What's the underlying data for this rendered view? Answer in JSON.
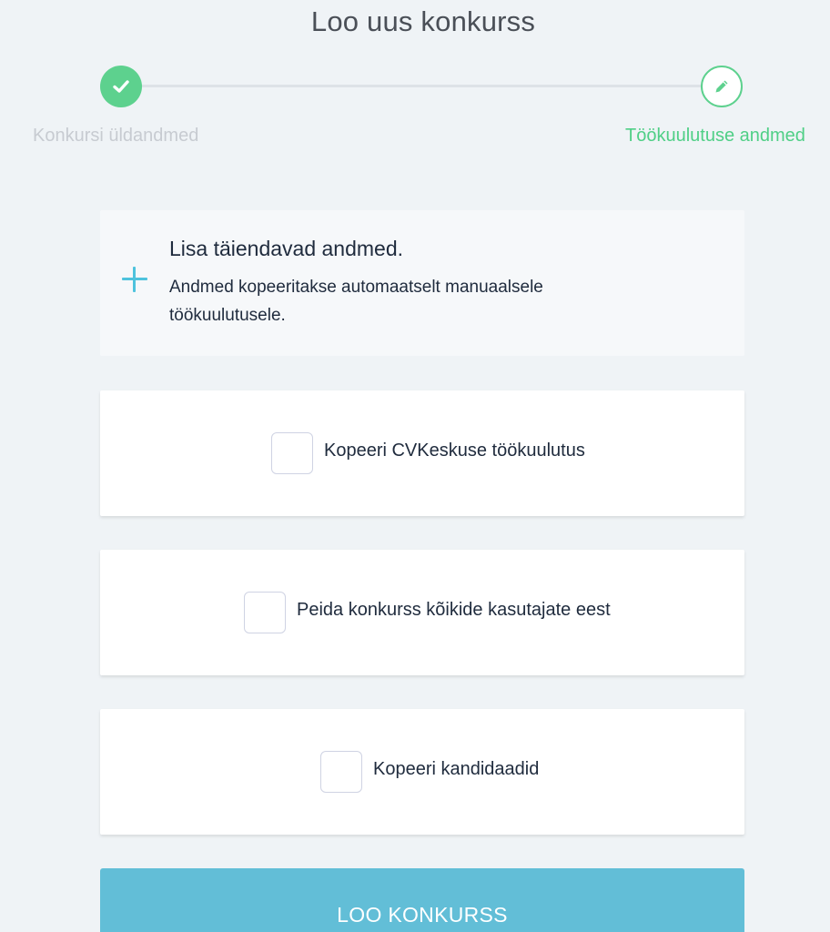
{
  "page": {
    "title": "Loo uus konkurss"
  },
  "stepper": {
    "steps": [
      {
        "label": "Konkursi üldandmed",
        "status": "completed",
        "icon": "check-icon"
      },
      {
        "label": "Töökuulutuse andmed",
        "status": "active",
        "icon": "pencil-icon"
      }
    ]
  },
  "info": {
    "icon": "plus-icon",
    "heading": "Lisa täiendavad andmed.",
    "text": "Andmed kopeeritakse automaatselt manuaalsele töökuulutusele."
  },
  "options": [
    {
      "label": "Kopeeri CVKeskuse töökuulutus",
      "checked": false
    },
    {
      "label": "Peida konkurss kõikide kasutajate eest",
      "checked": false
    },
    {
      "label": "Kopeeri kandidaadid",
      "checked": false
    }
  ],
  "submit": {
    "label": "LOO KONKURSS"
  },
  "colors": {
    "background": "#eff3f6",
    "success_green": "#5dd18e",
    "accent_blue": "#62bed7",
    "plus_blue": "#4ec3dd",
    "text_dark": "#1f2b3d",
    "text_muted": "#c7cbd1"
  }
}
